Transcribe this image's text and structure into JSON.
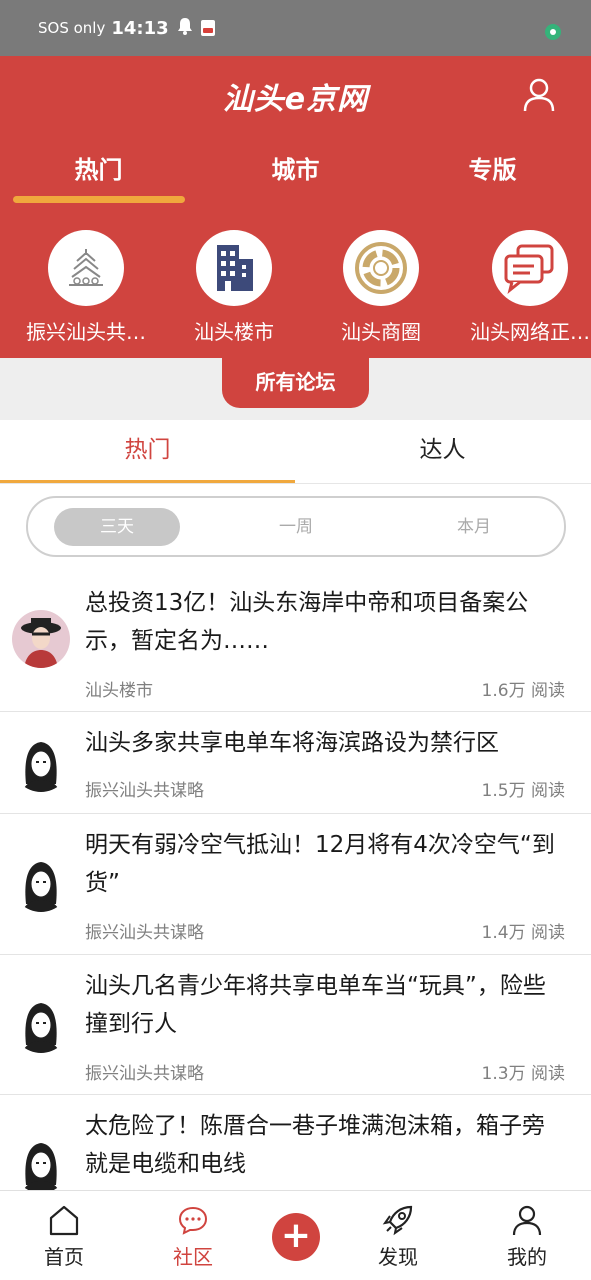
{
  "status_bar": {
    "network": "SOS only",
    "time": "14:13"
  },
  "header": {
    "logo": "汕头e京网",
    "tabs": [
      {
        "label": "热门",
        "active": true
      },
      {
        "label": "城市",
        "active": false
      },
      {
        "label": "专版",
        "active": false
      }
    ]
  },
  "forums": [
    {
      "label": "振兴汕头共…",
      "icon": "pagoda-icon"
    },
    {
      "label": "汕头楼市",
      "icon": "building-icon"
    },
    {
      "label": "汕头商圈",
      "icon": "ring-chart-icon"
    },
    {
      "label": "汕头网络正…",
      "icon": "chat-bubbles-icon"
    }
  ],
  "all_forums_label": "所有论坛",
  "sub_tabs": [
    {
      "label": "热门",
      "active": true
    },
    {
      "label": "达人",
      "active": false
    }
  ],
  "segments": [
    {
      "label": "三天",
      "active": true
    },
    {
      "label": "一周",
      "active": false
    },
    {
      "label": "本月",
      "active": false
    }
  ],
  "posts": [
    {
      "title": "总投资13亿！汕头东海岸中帝和项目备案公示，暂定名为……",
      "forum": "汕头楼市",
      "reads": "1.6万 阅读"
    },
    {
      "title": "汕头多家共享电单车将海滨路设为禁行区",
      "forum": "振兴汕头共谋略",
      "reads": "1.5万 阅读"
    },
    {
      "title": "明天有弱冷空气抵汕！12月将有4次冷空气“到货”",
      "forum": "振兴汕头共谋略",
      "reads": "1.4万 阅读"
    },
    {
      "title": "汕头几名青少年将共享电单车当“玩具”，险些撞到行人",
      "forum": "振兴汕头共谋略",
      "reads": "1.3万 阅读"
    },
    {
      "title": "太危险了！陈厝合一巷子堆满泡沫箱，箱子旁就是电缆和电线",
      "forum": "",
      "reads": ""
    }
  ],
  "bottom_nav": [
    {
      "label": "首页",
      "icon": "home-icon",
      "active": false
    },
    {
      "label": "社区",
      "icon": "community-icon",
      "active": true
    },
    {
      "label": "发现",
      "icon": "rocket-icon",
      "active": false
    },
    {
      "label": "我的",
      "icon": "profile-icon",
      "active": false
    }
  ],
  "colors": {
    "brand_red": "#d0443f",
    "accent_orange": "#f0a83d"
  }
}
